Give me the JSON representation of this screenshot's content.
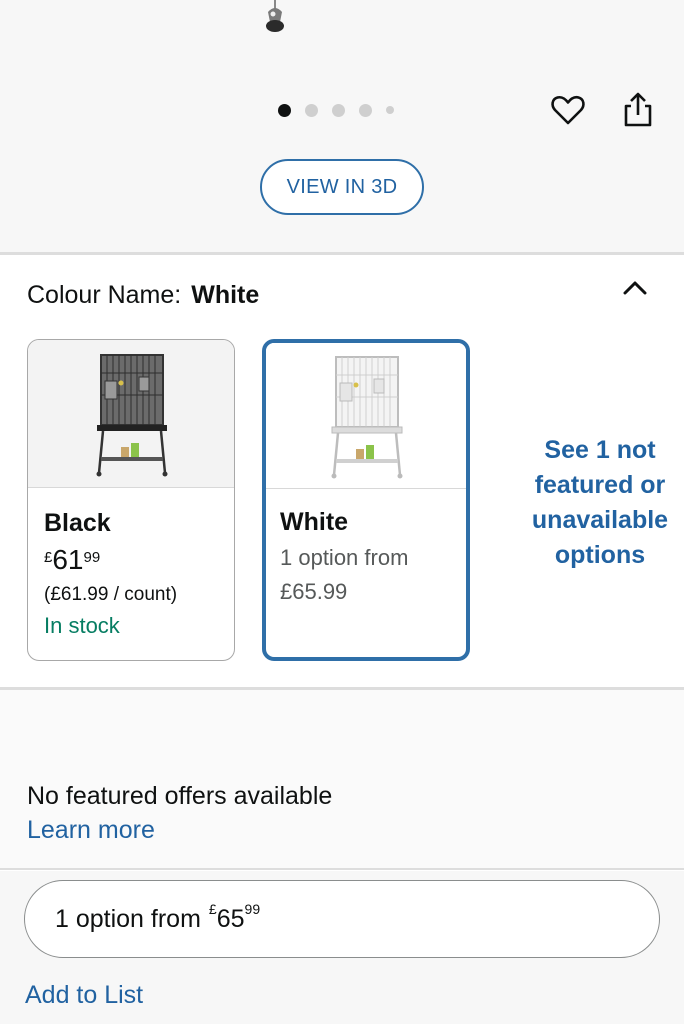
{
  "gallery": {
    "dot_count": 5,
    "active_dot": 1,
    "view_3d_label": "VIEW IN 3D"
  },
  "actions": {
    "wishlist_icon": "heart-icon",
    "share_icon": "share-icon"
  },
  "colour": {
    "label": "Colour Name:",
    "selected": "White",
    "collapse_icon": "chevron-up-icon"
  },
  "swatches": [
    {
      "name": "Black",
      "currency": "£",
      "price_whole": "61",
      "price_fraction": "99",
      "per_count": "(£61.99 / count)",
      "stock": "In stock"
    },
    {
      "name": "White",
      "option_text": "1 option from",
      "price": "£65.99"
    }
  ],
  "see_more": {
    "line1": "See 1 not",
    "line2": "featured or",
    "line3": "unavailable",
    "line4": "options"
  },
  "offers": {
    "no_offers": "No featured offers available",
    "learn_more": "Learn more"
  },
  "option_button": {
    "text": "1 option from",
    "currency": "£",
    "price_whole": "65",
    "price_fraction": "99"
  },
  "add_to_list": "Add to List",
  "colors": {
    "link_blue": "#2162a1",
    "selected_border": "#2f6fa8",
    "in_stock_green": "#067d62"
  }
}
